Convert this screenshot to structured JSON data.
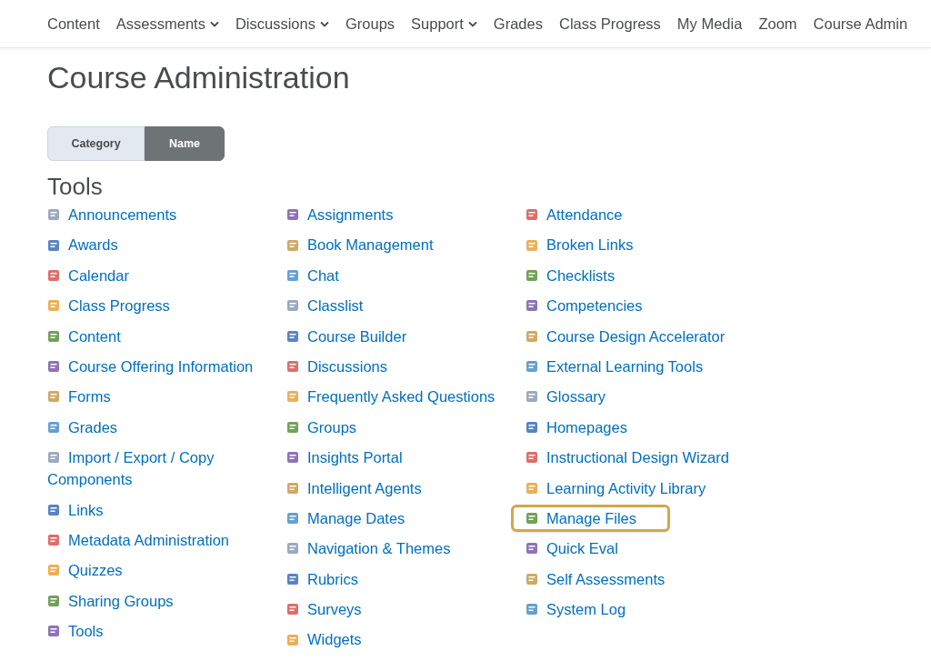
{
  "nav": [
    {
      "label": "Content",
      "dropdown": false
    },
    {
      "label": "Assessments",
      "dropdown": true
    },
    {
      "label": "Discussions",
      "dropdown": true
    },
    {
      "label": "Groups",
      "dropdown": false
    },
    {
      "label": "Support",
      "dropdown": true
    },
    {
      "label": "Grades",
      "dropdown": false
    },
    {
      "label": "Class Progress",
      "dropdown": false
    },
    {
      "label": "My Media",
      "dropdown": false
    },
    {
      "label": "Zoom",
      "dropdown": false
    },
    {
      "label": "Course Admin",
      "dropdown": false
    }
  ],
  "title": "Course Administration",
  "view_toggle": [
    {
      "label": "Category",
      "selected": false
    },
    {
      "label": "Name",
      "selected": true
    }
  ],
  "section_title": "Tools",
  "columns": [
    [
      {
        "label": "Announcements",
        "highlighted": false
      },
      {
        "label": "Awards",
        "highlighted": false
      },
      {
        "label": "Calendar",
        "highlighted": false
      },
      {
        "label": "Class Progress",
        "highlighted": false
      },
      {
        "label": "Content",
        "highlighted": false
      },
      {
        "label": "Course Offering Information",
        "highlighted": false
      },
      {
        "label": "Forms",
        "highlighted": false
      },
      {
        "label": "Grades",
        "highlighted": false
      },
      {
        "label": "Import / Export / Copy Components",
        "highlighted": false
      },
      {
        "label": "Links",
        "highlighted": false
      },
      {
        "label": "Metadata Administration",
        "highlighted": false
      },
      {
        "label": "Quizzes",
        "highlighted": false
      },
      {
        "label": "Sharing Groups",
        "highlighted": false
      },
      {
        "label": "Tools",
        "highlighted": false
      }
    ],
    [
      {
        "label": "Assignments",
        "highlighted": false
      },
      {
        "label": "Book Management",
        "highlighted": false
      },
      {
        "label": "Chat",
        "highlighted": false
      },
      {
        "label": "Classlist",
        "highlighted": false
      },
      {
        "label": "Course Builder",
        "highlighted": false
      },
      {
        "label": "Discussions",
        "highlighted": false
      },
      {
        "label": "Frequently Asked Questions",
        "highlighted": false
      },
      {
        "label": "Groups",
        "highlighted": false
      },
      {
        "label": "Insights Portal",
        "highlighted": false
      },
      {
        "label": "Intelligent Agents",
        "highlighted": false
      },
      {
        "label": "Manage Dates",
        "highlighted": false
      },
      {
        "label": "Navigation & Themes",
        "highlighted": false
      },
      {
        "label": "Rubrics",
        "highlighted": false
      },
      {
        "label": "Surveys",
        "highlighted": false
      },
      {
        "label": "Widgets",
        "highlighted": false
      }
    ],
    [
      {
        "label": "Attendance",
        "highlighted": false
      },
      {
        "label": "Broken Links",
        "highlighted": false
      },
      {
        "label": "Checklists",
        "highlighted": false
      },
      {
        "label": "Competencies",
        "highlighted": false
      },
      {
        "label": "Course Design Accelerator",
        "highlighted": false
      },
      {
        "label": "External Learning Tools",
        "highlighted": false
      },
      {
        "label": "Glossary",
        "highlighted": false
      },
      {
        "label": "Homepages",
        "highlighted": false
      },
      {
        "label": "Instructional Design Wizard",
        "highlighted": false
      },
      {
        "label": "Learning Activity Library",
        "highlighted": false
      },
      {
        "label": "Manage Files",
        "highlighted": true
      },
      {
        "label": "Quick Eval",
        "highlighted": false
      },
      {
        "label": "Self Assessments",
        "highlighted": false
      },
      {
        "label": "System Log",
        "highlighted": false
      }
    ]
  ]
}
